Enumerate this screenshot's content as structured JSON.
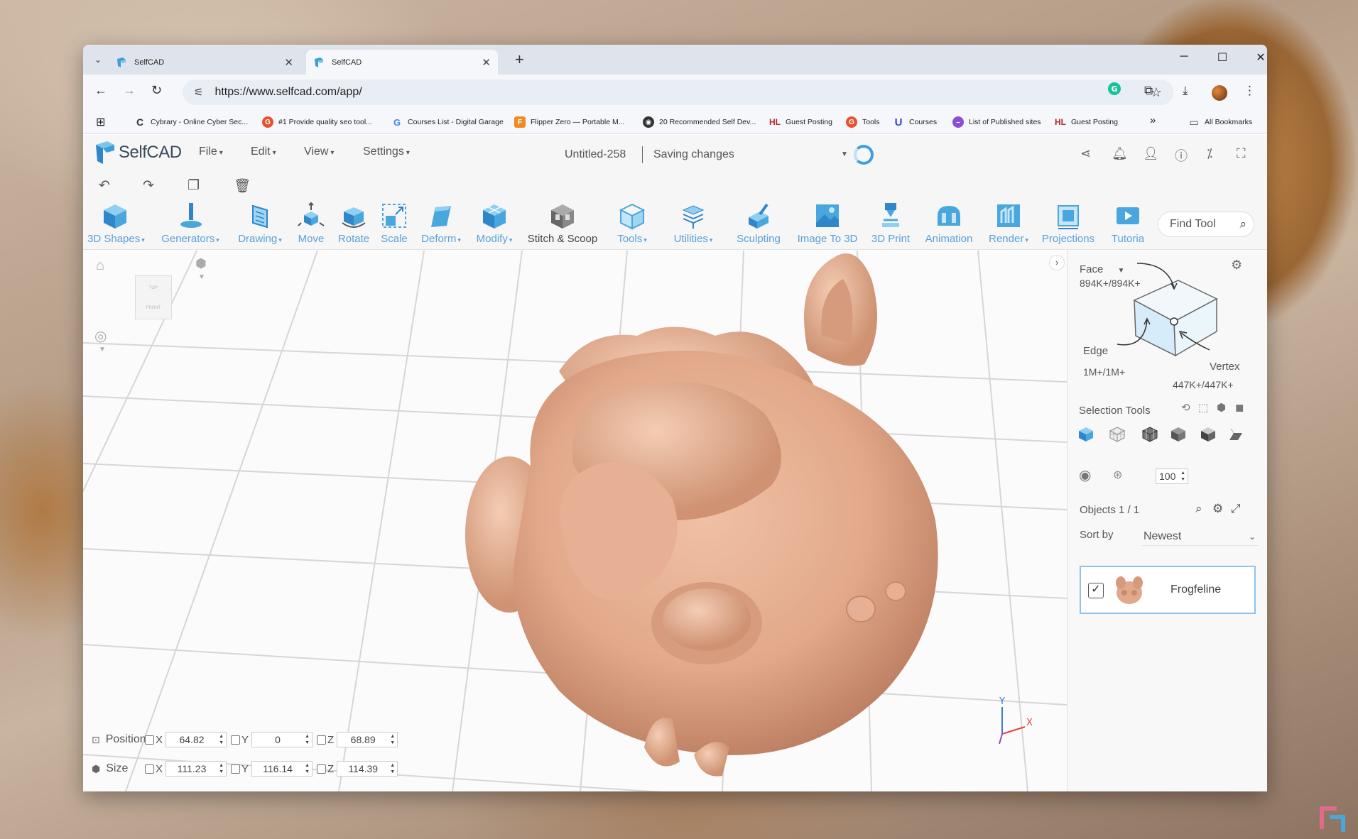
{
  "browser": {
    "tabs": [
      {
        "title": "SelfCAD",
        "active": false
      },
      {
        "title": "SelfCAD",
        "active": true
      }
    ],
    "new_tab": "+",
    "url": "https://www.selfcad.com/app/",
    "bookmarks": [
      {
        "label": "Cybrary - Online Cyber Sec...",
        "icon": "c-icon"
      },
      {
        "label": "#1 Provide quality seo tool...",
        "icon": "seo-icon"
      },
      {
        "label": "Courses List - Digital Garage",
        "icon": "google-icon"
      },
      {
        "label": "Flipper Zero — Portable M...",
        "icon": "flipper-icon"
      },
      {
        "label": "20 Recommended Self Dev...",
        "icon": "globe-icon"
      },
      {
        "label": "Guest Posting",
        "icon": "hl-icon"
      },
      {
        "label": "Tools",
        "icon": "tools-icon"
      },
      {
        "label": "Courses",
        "icon": "u-icon"
      },
      {
        "label": "List of Published sites",
        "icon": "purple-icon"
      },
      {
        "label": "Guest Posting",
        "icon": "hl-icon"
      }
    ],
    "more_bookmarks": "»",
    "all_bookmarks": "All Bookmarks"
  },
  "app": {
    "brand": "SelfCAD",
    "menus": [
      "File",
      "Edit",
      "View",
      "Settings"
    ],
    "document_name": "Untitled-258",
    "save_status": "Saving changes"
  },
  "toolbar": {
    "tools": [
      {
        "label": "3D Shapes",
        "dropdown": true
      },
      {
        "label": "Generators",
        "dropdown": true
      },
      {
        "label": "Drawing",
        "dropdown": true
      },
      {
        "label": "Move",
        "dropdown": false
      },
      {
        "label": "Rotate",
        "dropdown": false
      },
      {
        "label": "Scale",
        "dropdown": false
      },
      {
        "label": "Deform",
        "dropdown": true
      },
      {
        "label": "Modify",
        "dropdown": true
      },
      {
        "label": "Stitch & Scoop",
        "dropdown": false
      },
      {
        "label": "Tools",
        "dropdown": true
      },
      {
        "label": "Utilities",
        "dropdown": true
      },
      {
        "label": "Sculpting",
        "dropdown": false
      },
      {
        "label": "Image To 3D",
        "dropdown": false
      },
      {
        "label": "3D Print",
        "dropdown": false
      },
      {
        "label": "Animation",
        "dropdown": false
      },
      {
        "label": "Render",
        "dropdown": true
      },
      {
        "label": "Projections",
        "dropdown": false
      },
      {
        "label": "Tutoria",
        "dropdown": false
      }
    ],
    "find_tool_placeholder": "Find Tool"
  },
  "viewport": {
    "navcube_top": "TOP",
    "navcube_front": "FRONT",
    "position": {
      "label": "Position",
      "x": "64.82",
      "y": "0",
      "z": "68.89"
    },
    "size": {
      "label": "Size",
      "x": "111.23",
      "y": "116.14",
      "z": "114.39"
    },
    "axis_labels": {
      "x": "X",
      "y": "Y",
      "z": "Z"
    },
    "gizmo": {
      "x": "X",
      "y": "Y"
    }
  },
  "selection_panel": {
    "mode": "Face",
    "face_count": "894K+/894K+",
    "edge_label": "Edge",
    "edge_count": "1M+/1M+",
    "vertex_label": "Vertex",
    "vertex_count": "447K+/447K+",
    "selection_tools_label": "Selection Tools",
    "brush_value": "100",
    "objects_label": "Objects 1 / 1",
    "sort_label": "Sort by",
    "sort_value": "Newest",
    "objects": [
      {
        "name": "Frogfeline",
        "checked": true
      }
    ]
  },
  "colors": {
    "accent": "#5aa0d8",
    "model": "#e2a88a",
    "selection_border": "#8fc4ea"
  }
}
